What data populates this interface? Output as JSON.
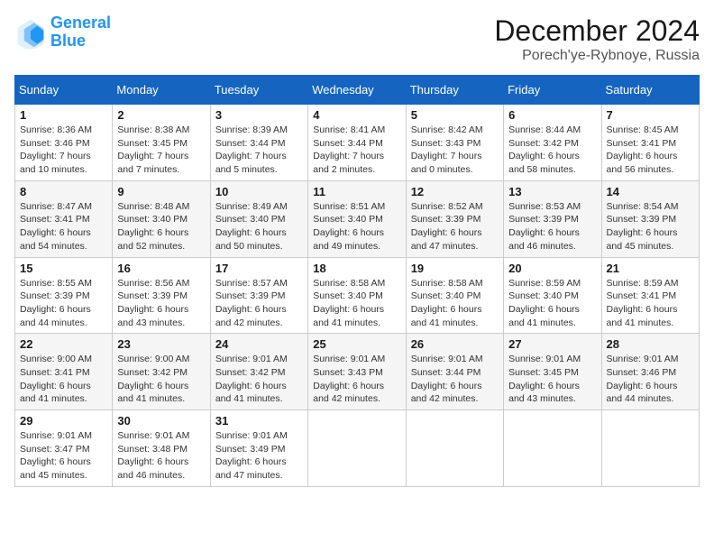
{
  "header": {
    "logo_line1": "General",
    "logo_line2": "Blue",
    "month": "December 2024",
    "location": "Porech'ye-Rybnoye, Russia"
  },
  "weekdays": [
    "Sunday",
    "Monday",
    "Tuesday",
    "Wednesday",
    "Thursday",
    "Friday",
    "Saturday"
  ],
  "weeks": [
    [
      {
        "day": "1",
        "info": "Sunrise: 8:36 AM\nSunset: 3:46 PM\nDaylight: 7 hours\nand 10 minutes."
      },
      {
        "day": "2",
        "info": "Sunrise: 8:38 AM\nSunset: 3:45 PM\nDaylight: 7 hours\nand 7 minutes."
      },
      {
        "day": "3",
        "info": "Sunrise: 8:39 AM\nSunset: 3:44 PM\nDaylight: 7 hours\nand 5 minutes."
      },
      {
        "day": "4",
        "info": "Sunrise: 8:41 AM\nSunset: 3:44 PM\nDaylight: 7 hours\nand 2 minutes."
      },
      {
        "day": "5",
        "info": "Sunrise: 8:42 AM\nSunset: 3:43 PM\nDaylight: 7 hours\nand 0 minutes."
      },
      {
        "day": "6",
        "info": "Sunrise: 8:44 AM\nSunset: 3:42 PM\nDaylight: 6 hours\nand 58 minutes."
      },
      {
        "day": "7",
        "info": "Sunrise: 8:45 AM\nSunset: 3:41 PM\nDaylight: 6 hours\nand 56 minutes."
      }
    ],
    [
      {
        "day": "8",
        "info": "Sunrise: 8:47 AM\nSunset: 3:41 PM\nDaylight: 6 hours\nand 54 minutes."
      },
      {
        "day": "9",
        "info": "Sunrise: 8:48 AM\nSunset: 3:40 PM\nDaylight: 6 hours\nand 52 minutes."
      },
      {
        "day": "10",
        "info": "Sunrise: 8:49 AM\nSunset: 3:40 PM\nDaylight: 6 hours\nand 50 minutes."
      },
      {
        "day": "11",
        "info": "Sunrise: 8:51 AM\nSunset: 3:40 PM\nDaylight: 6 hours\nand 49 minutes."
      },
      {
        "day": "12",
        "info": "Sunrise: 8:52 AM\nSunset: 3:39 PM\nDaylight: 6 hours\nand 47 minutes."
      },
      {
        "day": "13",
        "info": "Sunrise: 8:53 AM\nSunset: 3:39 PM\nDaylight: 6 hours\nand 46 minutes."
      },
      {
        "day": "14",
        "info": "Sunrise: 8:54 AM\nSunset: 3:39 PM\nDaylight: 6 hours\nand 45 minutes."
      }
    ],
    [
      {
        "day": "15",
        "info": "Sunrise: 8:55 AM\nSunset: 3:39 PM\nDaylight: 6 hours\nand 44 minutes."
      },
      {
        "day": "16",
        "info": "Sunrise: 8:56 AM\nSunset: 3:39 PM\nDaylight: 6 hours\nand 43 minutes."
      },
      {
        "day": "17",
        "info": "Sunrise: 8:57 AM\nSunset: 3:39 PM\nDaylight: 6 hours\nand 42 minutes."
      },
      {
        "day": "18",
        "info": "Sunrise: 8:58 AM\nSunset: 3:40 PM\nDaylight: 6 hours\nand 41 minutes."
      },
      {
        "day": "19",
        "info": "Sunrise: 8:58 AM\nSunset: 3:40 PM\nDaylight: 6 hours\nand 41 minutes."
      },
      {
        "day": "20",
        "info": "Sunrise: 8:59 AM\nSunset: 3:40 PM\nDaylight: 6 hours\nand 41 minutes."
      },
      {
        "day": "21",
        "info": "Sunrise: 8:59 AM\nSunset: 3:41 PM\nDaylight: 6 hours\nand 41 minutes."
      }
    ],
    [
      {
        "day": "22",
        "info": "Sunrise: 9:00 AM\nSunset: 3:41 PM\nDaylight: 6 hours\nand 41 minutes."
      },
      {
        "day": "23",
        "info": "Sunrise: 9:00 AM\nSunset: 3:42 PM\nDaylight: 6 hours\nand 41 minutes."
      },
      {
        "day": "24",
        "info": "Sunrise: 9:01 AM\nSunset: 3:42 PM\nDaylight: 6 hours\nand 41 minutes."
      },
      {
        "day": "25",
        "info": "Sunrise: 9:01 AM\nSunset: 3:43 PM\nDaylight: 6 hours\nand 42 minutes."
      },
      {
        "day": "26",
        "info": "Sunrise: 9:01 AM\nSunset: 3:44 PM\nDaylight: 6 hours\nand 42 minutes."
      },
      {
        "day": "27",
        "info": "Sunrise: 9:01 AM\nSunset: 3:45 PM\nDaylight: 6 hours\nand 43 minutes."
      },
      {
        "day": "28",
        "info": "Sunrise: 9:01 AM\nSunset: 3:46 PM\nDaylight: 6 hours\nand 44 minutes."
      }
    ],
    [
      {
        "day": "29",
        "info": "Sunrise: 9:01 AM\nSunset: 3:47 PM\nDaylight: 6 hours\nand 45 minutes."
      },
      {
        "day": "30",
        "info": "Sunrise: 9:01 AM\nSunset: 3:48 PM\nDaylight: 6 hours\nand 46 minutes."
      },
      {
        "day": "31",
        "info": "Sunrise: 9:01 AM\nSunset: 3:49 PM\nDaylight: 6 hours\nand 47 minutes."
      },
      {
        "day": "",
        "info": ""
      },
      {
        "day": "",
        "info": ""
      },
      {
        "day": "",
        "info": ""
      },
      {
        "day": "",
        "info": ""
      }
    ]
  ]
}
